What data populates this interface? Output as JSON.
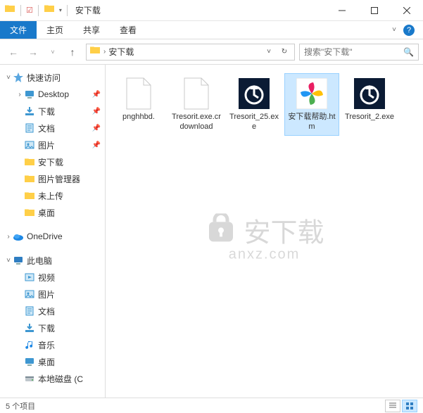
{
  "window": {
    "title": "安下载"
  },
  "tabs": {
    "file": "文件",
    "home": "主页",
    "share": "共享",
    "view": "查看"
  },
  "address": {
    "location": "安下载"
  },
  "search": {
    "placeholder": "搜索\"安下载\""
  },
  "sidebar": {
    "quick_access": "快速访问",
    "items_quick": [
      {
        "label": "Desktop",
        "icon": "desktop",
        "pinned": true
      },
      {
        "label": "下载",
        "icon": "downloads",
        "pinned": true
      },
      {
        "label": "文档",
        "icon": "documents",
        "pinned": true
      },
      {
        "label": "图片",
        "icon": "pictures",
        "pinned": true
      },
      {
        "label": "安下载",
        "icon": "folder",
        "pinned": false
      },
      {
        "label": "图片管理器",
        "icon": "folder",
        "pinned": false
      },
      {
        "label": "未上传",
        "icon": "folder",
        "pinned": false
      },
      {
        "label": "桌面",
        "icon": "folder",
        "pinned": false
      }
    ],
    "onedrive": "OneDrive",
    "this_pc": "此电脑",
    "items_pc": [
      {
        "label": "视频",
        "icon": "videos"
      },
      {
        "label": "图片",
        "icon": "pictures"
      },
      {
        "label": "文档",
        "icon": "documents"
      },
      {
        "label": "下载",
        "icon": "downloads"
      },
      {
        "label": "音乐",
        "icon": "music"
      },
      {
        "label": "桌面",
        "icon": "desktop"
      },
      {
        "label": "本地磁盘 (C",
        "icon": "disk"
      }
    ]
  },
  "files": [
    {
      "name": "pnghhbd.",
      "icon": "blank",
      "selected": false
    },
    {
      "name": "Tresorit.exe.crdownload",
      "icon": "blank",
      "selected": false
    },
    {
      "name": "Tresorit_25.exe",
      "icon": "tresorit",
      "selected": false
    },
    {
      "name": "安下载帮助.htm",
      "icon": "pinwheel",
      "selected": true
    },
    {
      "name": "Tresorit_2.exe",
      "icon": "tresorit",
      "selected": false
    }
  ],
  "status": {
    "count_text": "5 个项目"
  },
  "watermark": {
    "text": "安下载",
    "sub": "anxz.com"
  }
}
